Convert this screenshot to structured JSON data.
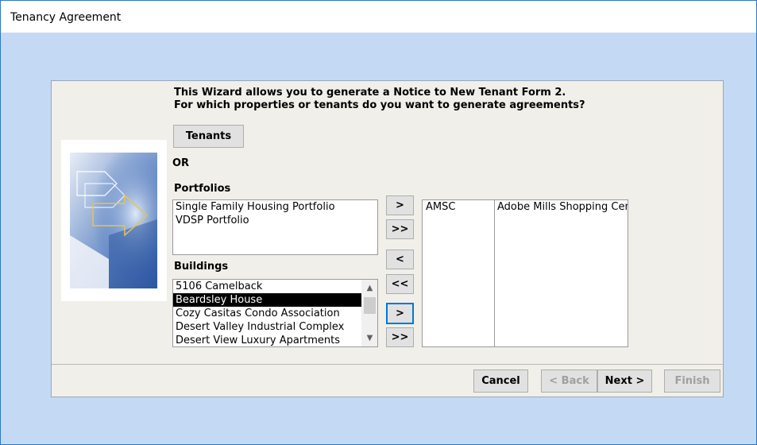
{
  "window": {
    "title": "Tenancy Agreement"
  },
  "intro": {
    "line1": "This Wizard allows you to generate a Notice to New Tenant Form 2.",
    "line2": "For which properties or tenants do you want to generate agreements?"
  },
  "tenants_button": "Tenants",
  "or_label": "OR",
  "portfolios": {
    "label": "Portfolios",
    "items": [
      "Single Family Housing Portfolio",
      "VDSP Portfolio"
    ]
  },
  "buildings": {
    "label": "Buildings",
    "items": [
      "5106 Camelback",
      "Beardsley House",
      "Cozy Casitas Condo Association",
      "Desert Valley Industrial Complex",
      "Desert View Luxury Apartments"
    ],
    "selected_index": 1
  },
  "move_buttons": {
    "add_portfolio": ">",
    "add_all_portfolios": ">>",
    "remove": "<",
    "remove_all": "<<",
    "add_building": ">",
    "add_all_buildings": ">>"
  },
  "selected": {
    "rows": [
      {
        "code": "AMSC",
        "name": "Adobe Mills Shopping Cent"
      }
    ]
  },
  "footer": {
    "cancel": "Cancel",
    "back": "< Back",
    "next": "Next >",
    "finish": "Finish"
  },
  "colors": {
    "backdrop": "#c4d9f4",
    "panel": "#f0efe9",
    "selection": "#000000",
    "focus": "#0078d7"
  }
}
